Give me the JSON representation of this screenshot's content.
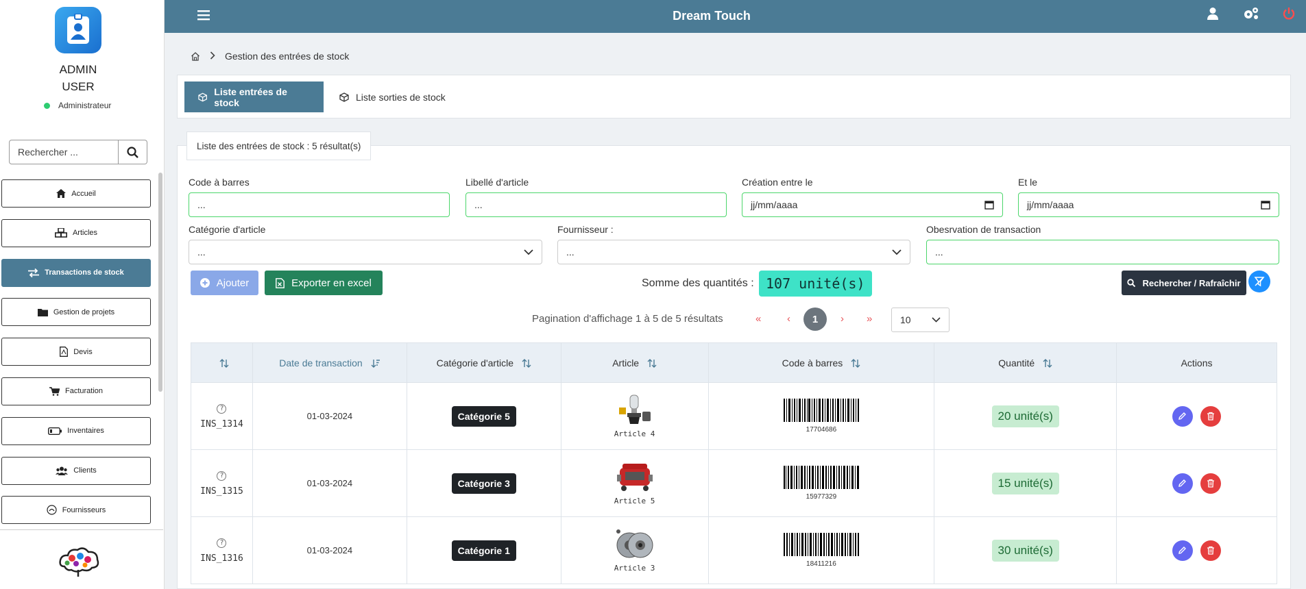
{
  "app": {
    "title": "Dream Touch"
  },
  "user": {
    "first": "ADMIN",
    "last": "USER",
    "role": "Administrateur"
  },
  "sidebar": {
    "search_placeholder": "Rechercher ...",
    "items": [
      {
        "label": "Accueil",
        "icon": "home-icon"
      },
      {
        "label": "Articles",
        "icon": "cubes-icon"
      },
      {
        "label": "Transactions de stock",
        "icon": "exchange-icon"
      },
      {
        "label": "Gestion de projets",
        "icon": "folder-icon"
      },
      {
        "label": "Devis",
        "icon": "pdf-icon"
      },
      {
        "label": "Facturation",
        "icon": "cart-icon"
      },
      {
        "label": "Inventaires",
        "icon": "battery-icon"
      },
      {
        "label": "Clients",
        "icon": "users-icon"
      },
      {
        "label": "Fournisseurs",
        "icon": "supplier-icon"
      }
    ]
  },
  "breadcrumb": {
    "current": "Gestion des entrées de stock"
  },
  "tabs": [
    {
      "label": "Liste entrées de stock",
      "active": true
    },
    {
      "label": "Liste sorties de stock",
      "active": false
    }
  ],
  "list": {
    "count_label": "Liste des entrées de stock : 5 résultat(s)"
  },
  "filters": {
    "barcode": {
      "label": "Code à barres",
      "placeholder": "..."
    },
    "article_label": {
      "label": "Libellé d'article",
      "placeholder": "..."
    },
    "created_from": {
      "label": "Création entre le",
      "value": "jj/mm/aaaa"
    },
    "created_to": {
      "label": "Et le",
      "value": "jj/mm/aaaa"
    },
    "category": {
      "label": "Catégorie d'article",
      "value": "..."
    },
    "supplier": {
      "label": "Fournisseur :",
      "value": "..."
    },
    "observation": {
      "label": "Obesrvation de transaction",
      "placeholder": "..."
    }
  },
  "actions": {
    "add": "Ajouter",
    "export": "Exporter en excel",
    "search": "Rechercher / Rafraîchir",
    "sum_label": "Somme des quantités :",
    "sum_value": "107 unité(s)"
  },
  "pagination": {
    "label": "Pagination d'affichage 1 à 5 de 5 résultats",
    "first": "«",
    "prev": "‹",
    "current": "1",
    "next": "›",
    "last": "»",
    "page_size": "10"
  },
  "table": {
    "headers": [
      "",
      "Date de transaction",
      "Catégorie d'article",
      "Article",
      "Code à barres",
      "Quantité",
      "Actions"
    ],
    "rows": [
      {
        "code": "INS_1314",
        "date": "01-03-2024",
        "category": "Catégorie 5",
        "article": "Article 4",
        "barcode": "17704686",
        "quantity": "20 unité(s)"
      },
      {
        "code": "INS_1315",
        "date": "01-03-2024",
        "category": "Catégorie 3",
        "article": "Article 5",
        "barcode": "15977329",
        "quantity": "15 unité(s)"
      },
      {
        "code": "INS_1316",
        "date": "01-03-2024",
        "category": "Catégorie 1",
        "article": "Article 3",
        "barcode": "18411216",
        "quantity": "30 unité(s)"
      }
    ]
  },
  "colors": {
    "primary": "#4b7b95",
    "input_border": "#4bd66a",
    "sum_badge": "#3ee2c7",
    "qty_badge": "#c7ecd1",
    "edit": "#6366f1",
    "delete": "#e53e3e"
  }
}
